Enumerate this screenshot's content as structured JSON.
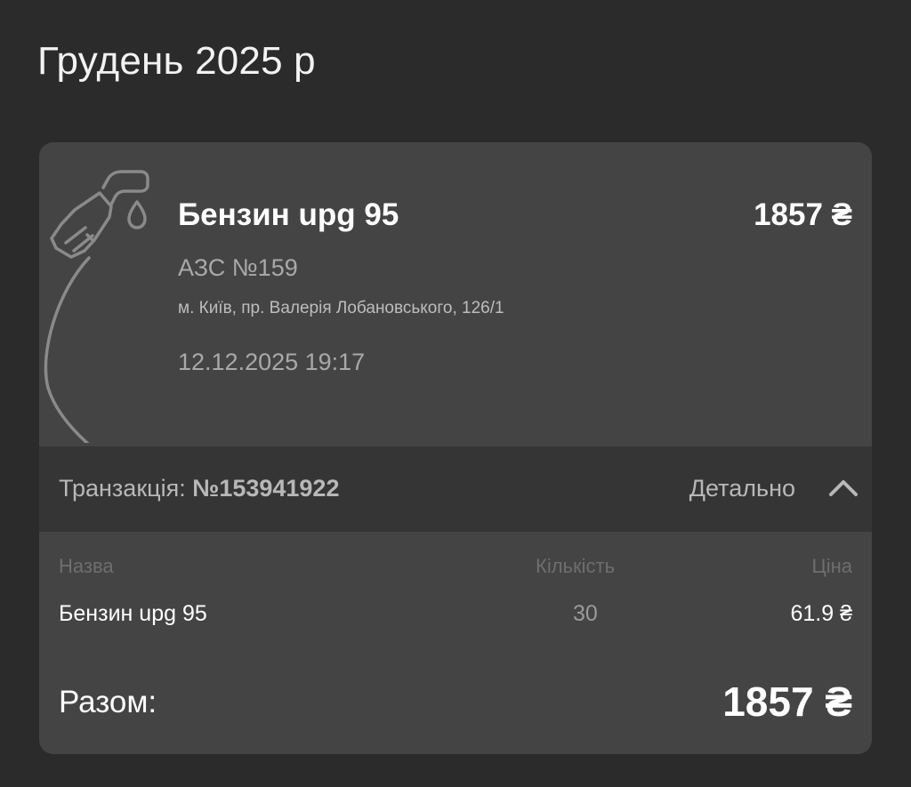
{
  "header": {
    "month_title": "Грудень 2025 р"
  },
  "receipt": {
    "icon": "fuel-pump-icon",
    "fuel_name": "Бензин upg 95",
    "total_top": "1857 ₴",
    "station_name": "АЗС №159",
    "station_address": "м. Київ, пр. Валерія Лобановського, 126/1",
    "datetime": "12.12.2025 19:17"
  },
  "transaction": {
    "label": "Транзакція: ",
    "number": "№153941922",
    "details_label": "Детально",
    "toggle_icon": "chevron-up-icon"
  },
  "items_table": {
    "headers": {
      "name": "Назва",
      "quantity": "Кількість",
      "price": "Ціна"
    },
    "rows": [
      {
        "name": "Бензин upg 95",
        "quantity": "30",
        "price": "61.9 ₴"
      }
    ]
  },
  "summary": {
    "label": "Разом:",
    "value": "1857 ₴"
  },
  "colors": {
    "background": "#2b2b2b",
    "card": "#444444",
    "transaction_bar": "#353535",
    "muted_text": "#a9a9a9",
    "header_text": "#6e6e6e"
  }
}
